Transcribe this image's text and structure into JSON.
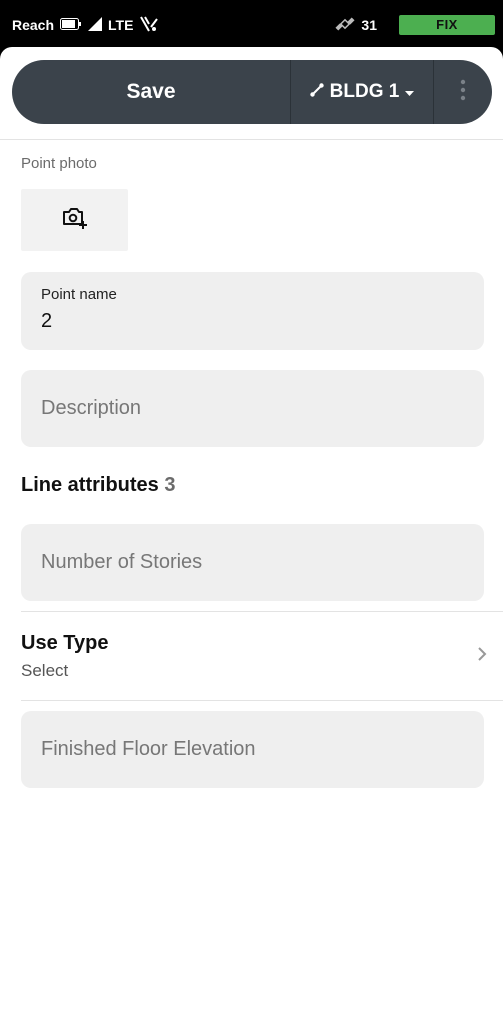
{
  "status_bar": {
    "carrier": "Reach",
    "network": "LTE",
    "satellites": "31",
    "fix": "FIX",
    "fix_color": "#4caf50"
  },
  "toolbar": {
    "save_label": "Save",
    "layer_label": "BLDG 1"
  },
  "photo": {
    "label": "Point photo"
  },
  "point_name": {
    "label": "Point name",
    "value": "2"
  },
  "description": {
    "placeholder": "Description"
  },
  "line_attributes": {
    "title": "Line attributes",
    "count": "3"
  },
  "stories": {
    "placeholder": "Number of Stories"
  },
  "use_type": {
    "title": "Use Type",
    "value": "Select"
  },
  "floor_elevation": {
    "placeholder": "Finished Floor Elevation"
  }
}
